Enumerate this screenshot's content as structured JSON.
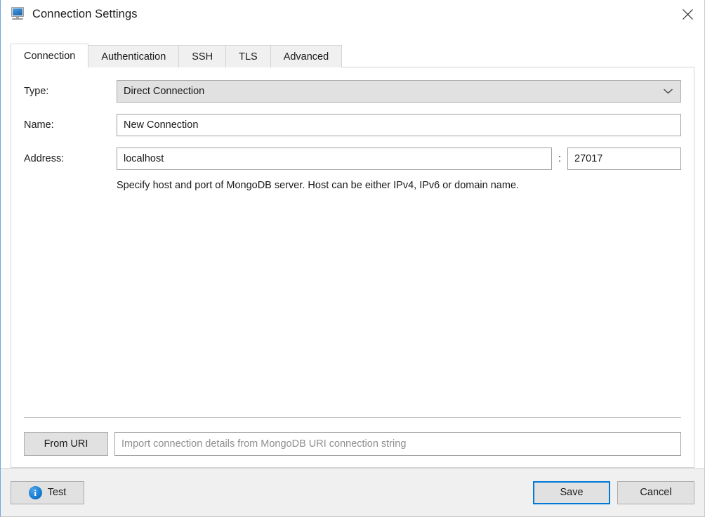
{
  "window": {
    "title": "Connection Settings",
    "icon": "monitor-icon",
    "close_icon": "close-icon"
  },
  "tabs": [
    {
      "label": "Connection",
      "active": true
    },
    {
      "label": "Authentication",
      "active": false
    },
    {
      "label": "SSH",
      "active": false
    },
    {
      "label": "TLS",
      "active": false
    },
    {
      "label": "Advanced",
      "active": false
    }
  ],
  "form": {
    "type": {
      "label": "Type:",
      "value": "Direct Connection",
      "arrow_icon": "chevron-down-icon"
    },
    "name": {
      "label": "Name:",
      "value": "New Connection"
    },
    "address": {
      "label": "Address:",
      "host_value": "localhost",
      "separator": ":",
      "port_value": "27017",
      "hint": "Specify host and port of MongoDB server. Host can be either IPv4, IPv6 or domain name."
    }
  },
  "uri": {
    "button_label": "From URI",
    "input_value": "",
    "input_placeholder": "Import connection details from MongoDB URI connection string"
  },
  "footer": {
    "test_label": "Test",
    "test_icon": "info-icon",
    "save_label": "Save",
    "cancel_label": "Cancel"
  },
  "colors": {
    "accent": "#0078d7",
    "button_face": "#e1e1e1",
    "footer_bg": "#f0f0f0",
    "border": "#adadad",
    "placeholder": "#8f8f8f"
  }
}
